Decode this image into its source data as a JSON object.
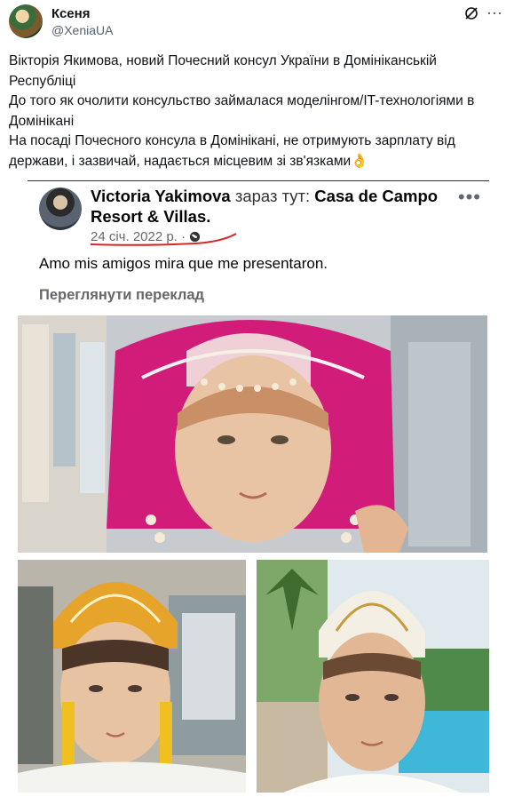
{
  "tweet": {
    "display_name": "Ксеня",
    "handle": "@XeniaUA",
    "text_lines": [
      "Вікторія Якимова, новий Почесний консул України в Домініканській Республіці",
      "До того як очолити консульство займалася моделінгом/IT-технологіями в Домінікані",
      "На посаді Почесного консула в Домінікані, не отримують зарплату від держави, і зазвичай, надається місцевим зі зв'язками👌"
    ]
  },
  "icons": {
    "avatar": "profile-avatar",
    "grok": "grok-icon",
    "more": "more-icon",
    "globe": "globe-icon"
  },
  "embedded_post": {
    "author": "Victoria Yakimova",
    "location_prefix": "зараз тут:",
    "location": "Casa de Campo",
    "location_line2": "Resort & Villas.",
    "date": "24 січ. 2022 р.",
    "date_separator": "·",
    "text": "Amo mis amigos mira que me presentaron.",
    "translate_link": "Переглянути переклад",
    "more_dots": "•••"
  },
  "colors": {
    "underline_red": "#d62828",
    "muted_text": "#536471",
    "fb_secondary": "#65676b"
  }
}
